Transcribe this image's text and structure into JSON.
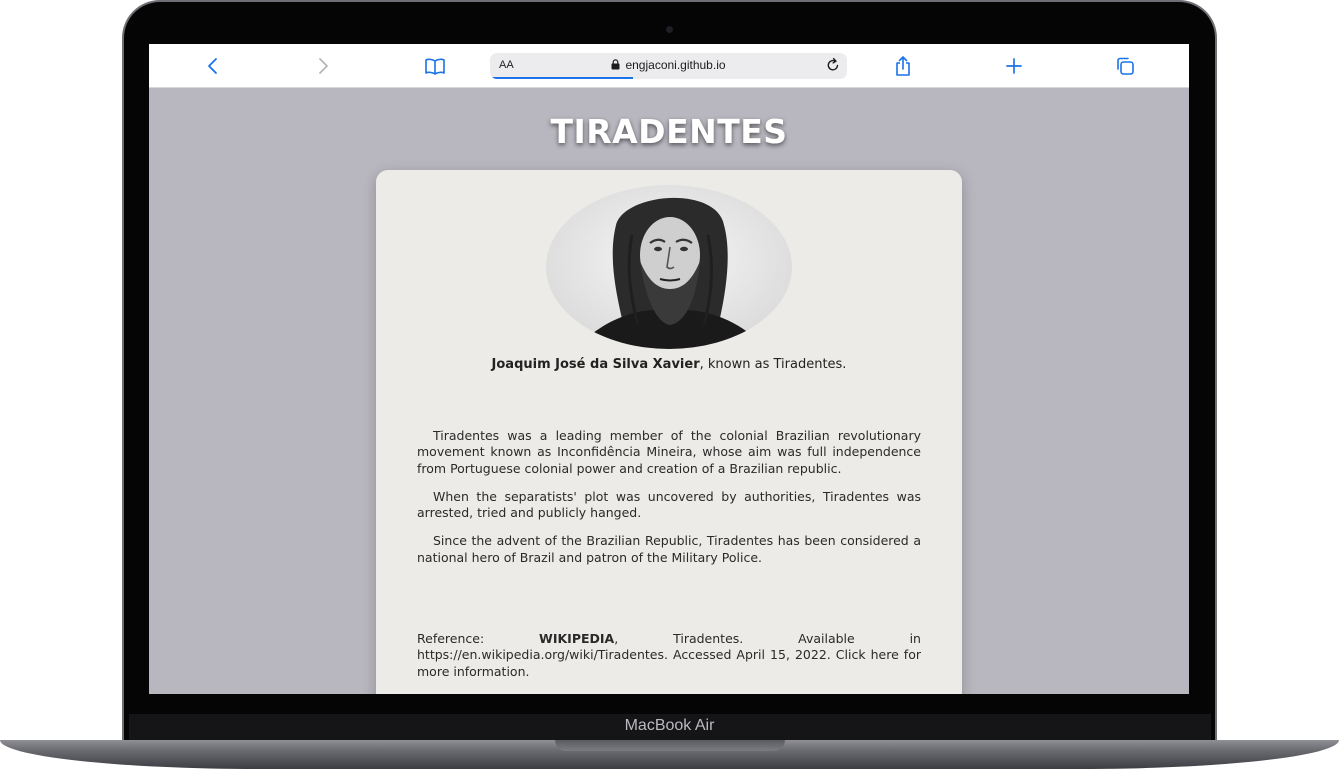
{
  "device": {
    "model_label": "MacBook Air"
  },
  "browser": {
    "text_size_label": "AA",
    "url": "engjaconi.github.io",
    "load_progress": 0.4,
    "icons": [
      "back-icon",
      "forward-icon",
      "bookmarks-icon",
      "lock-icon",
      "reload-icon",
      "share-icon",
      "new-tab-icon",
      "tabs-icon"
    ]
  },
  "page": {
    "title": "TIRADENTES",
    "portrait_alt": "Portrait of Tiradentes",
    "caption": {
      "name": "Joaquim José da Silva Xavier",
      "suffix": ", known as Tiradentes."
    },
    "paragraphs": [
      "Tiradentes was a leading member of the colonial Brazilian revolutionary movement known as Inconfidência Mineira, whose aim was full independence from Portuguese colonial power and creation of a Brazilian republic.",
      "When the separatists' plot was uncovered by authorities, Tiradentes was arrested, tried and publicly hanged.",
      "Since the advent of the Brazilian Republic, Tiradentes has been considered a national hero of Brazil and patron of the Military Police."
    ],
    "reference": {
      "prefix": "Reference: ",
      "source": "WIKIPEDIA",
      "text": ", Tiradentes. Available in https://en.wikipedia.org/wiki/Tiradentes. Accessed April 15, 2022. Click here for more information."
    }
  },
  "colors": {
    "page_background": "#b8b6be",
    "card_background": "#edebe7",
    "browser_accent": "#1a73e8",
    "title_text": "#ffffff"
  }
}
